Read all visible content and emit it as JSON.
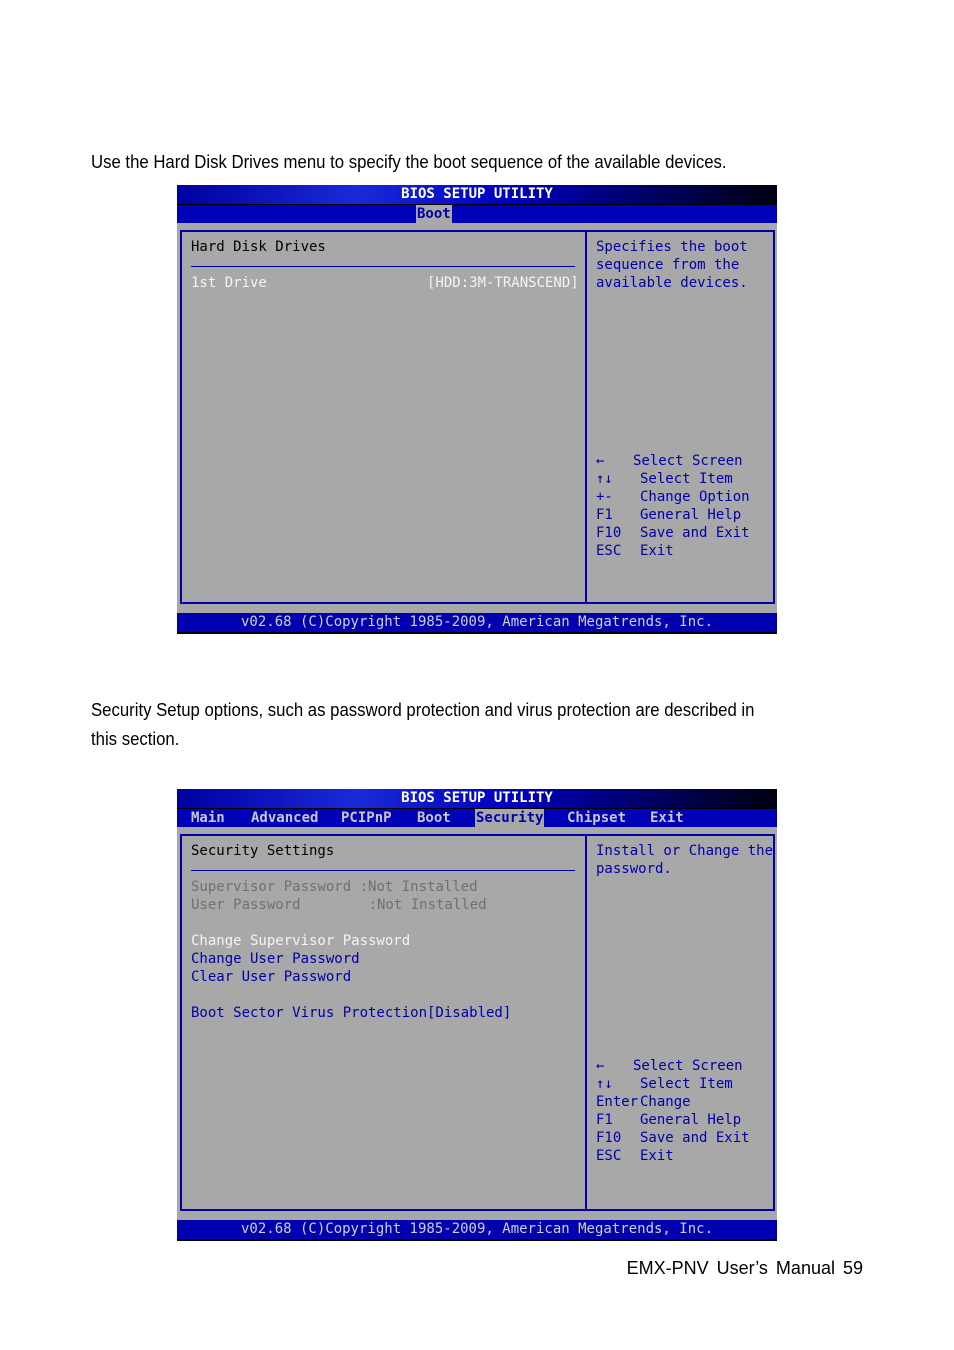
{
  "document": {
    "intro_1": "Use the Hard Disk Drives menu to specify the boot sequence of the available devices.",
    "intro_2_line1": "Security Setup options, such as password protection and virus protection are described in",
    "intro_2_line2": "this section.",
    "footer": "EMX-PNV  User’s  Manual  59"
  },
  "bios1": {
    "title": "BIOS SETUP UTILITY",
    "menu": [
      {
        "label": "Boot",
        "active": true
      }
    ],
    "section_title": "Hard Disk Drives",
    "items": [
      {
        "label": "1st Drive",
        "value": "[HDD:3M-TRANSCEND]"
      }
    ],
    "help_text": [
      "Specifies the boot",
      "sequence from the",
      "available devices."
    ],
    "keys": [
      {
        "key": "←",
        "action": "Select Screen"
      },
      {
        "key": "↑↓",
        "action": "Select Item"
      },
      {
        "key": "+-",
        "action": "Change Option"
      },
      {
        "key": "F1",
        "action": "General Help"
      },
      {
        "key": "F10",
        "action": "Save and Exit"
      },
      {
        "key": "ESC",
        "action": "Exit"
      }
    ],
    "status": "v02.68 (C)Copyright 1985-2009, American Megatrends, Inc."
  },
  "bios2": {
    "title": "BIOS SETUP UTILITY",
    "menu": [
      {
        "label": "Main",
        "active": false
      },
      {
        "label": "Advanced",
        "active": false
      },
      {
        "label": "PCIPnP",
        "active": false
      },
      {
        "label": "Boot",
        "active": false
      },
      {
        "label": "Security",
        "active": true
      },
      {
        "label": "Chipset",
        "active": false
      },
      {
        "label": "Exit",
        "active": false
      }
    ],
    "section_title": "Security Settings",
    "info": [
      {
        "label": "Supervisor Password",
        "value": ":Not Installed"
      },
      {
        "label": "User Password",
        "value": ":Not Installed"
      }
    ],
    "actions": [
      {
        "label": "Change Supervisor Password",
        "selected": true
      },
      {
        "label": "Change User Password",
        "selected": false
      },
      {
        "label": "Clear User Password",
        "selected": false
      }
    ],
    "option": {
      "label": "Boot Sector Virus Protection",
      "value": "[Disabled]"
    },
    "help_text": [
      "Install or Change the",
      "password."
    ],
    "keys": [
      {
        "key": "←",
        "action": "Select Screen"
      },
      {
        "key": "↑↓",
        "action": "Select Item"
      },
      {
        "key": "Enter",
        "action": "Change"
      },
      {
        "key": "F1",
        "action": "General Help"
      },
      {
        "key": "F10",
        "action": "Save and Exit"
      },
      {
        "key": "ESC",
        "action": "Exit"
      }
    ],
    "status": "v02.68 (C)Copyright 1985-2009, American Megatrends, Inc."
  },
  "colors": {
    "bios_blue": "#0000b8",
    "bios_grey": "#a8a8a8",
    "highlight_text": "#f4f4f4",
    "disabled_text": "#707070"
  }
}
